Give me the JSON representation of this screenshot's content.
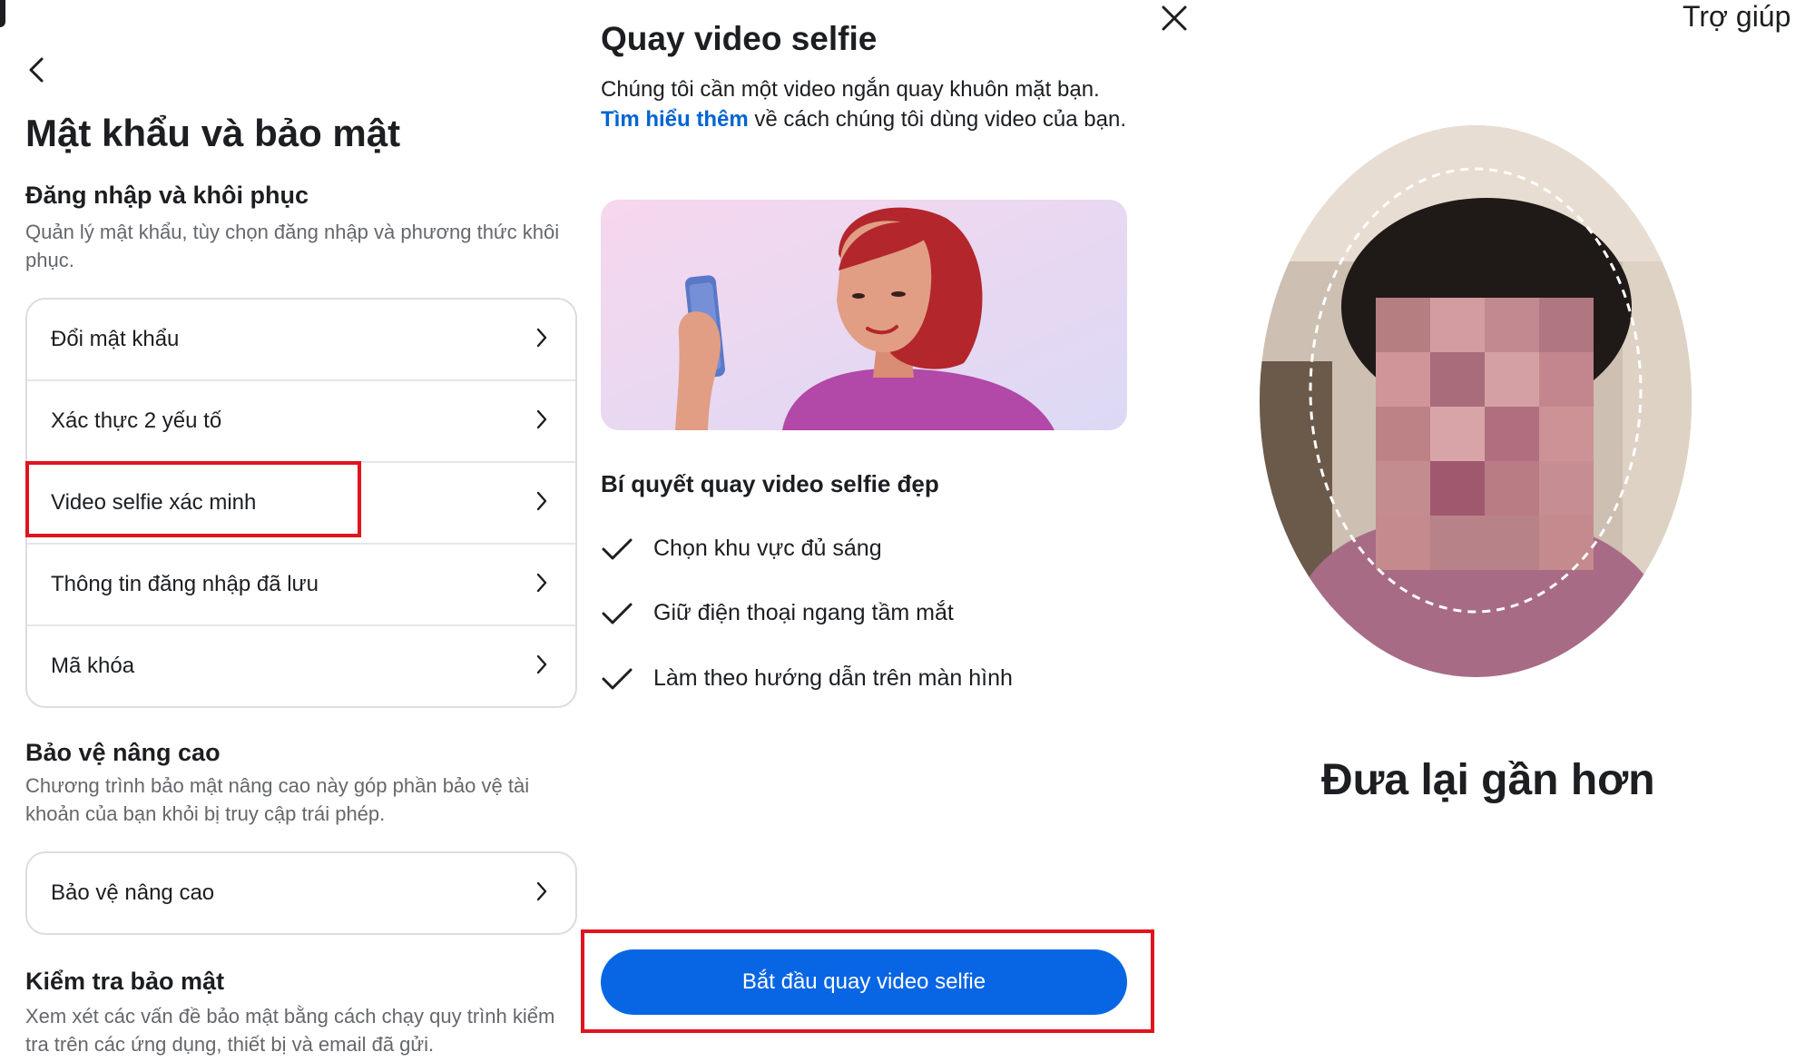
{
  "left_panel": {
    "title": "Mật khẩu và bảo mật",
    "login_section": {
      "title": "Đăng nhập và khôi phục",
      "description": "Quản lý mật khẩu, tùy chọn đăng nhập và phương thức khôi phục.",
      "items": [
        {
          "label": "Đổi mật khẩu"
        },
        {
          "label": "Xác thực 2 yếu tố"
        },
        {
          "label": "Video selfie xác minh"
        },
        {
          "label": "Thông tin đăng nhập đã lưu"
        },
        {
          "label": "Mã khóa"
        }
      ]
    },
    "advanced_section": {
      "title": "Bảo vệ nâng cao",
      "description": "Chương trình bảo mật nâng cao này góp phần bảo vệ tài khoản của bạn khỏi bị truy cập trái phép.",
      "items": [
        {
          "label": "Bảo vệ nâng cao"
        }
      ]
    },
    "checkup_section": {
      "title": "Kiểm tra bảo mật",
      "description": "Xem xét các vấn đề bảo mật bằng cách chạy quy trình kiểm tra trên các ứng dụng, thiết bị và email đã gửi."
    }
  },
  "middle_panel": {
    "title": "Quay video selfie",
    "description_before": "Chúng tôi cần một video ngắn quay khuôn mặt bạn. ",
    "description_link": "Tìm hiểu thêm",
    "description_after": " về cách chúng tôi dùng video của bạn.",
    "tips_title": "Bí quyết quay video selfie đẹp",
    "tips": [
      {
        "text": "Chọn khu vực đủ sáng"
      },
      {
        "text": "Giữ điện thoại ngang tầm mắt"
      },
      {
        "text": "Làm theo hướng dẫn trên màn hình"
      }
    ],
    "cta_label": "Bắt đầu quay video selfie"
  },
  "right_panel": {
    "help_label": "Trợ giúp",
    "instruction": "Đưa lại gần hơn"
  },
  "colors": {
    "accent_blue": "#0866e5",
    "link_blue": "#0064d1",
    "highlight_red": "#e0141f"
  },
  "icons": [
    "back-arrow-icon",
    "chevron-right-icon",
    "close-icon",
    "checkmark-icon"
  ]
}
